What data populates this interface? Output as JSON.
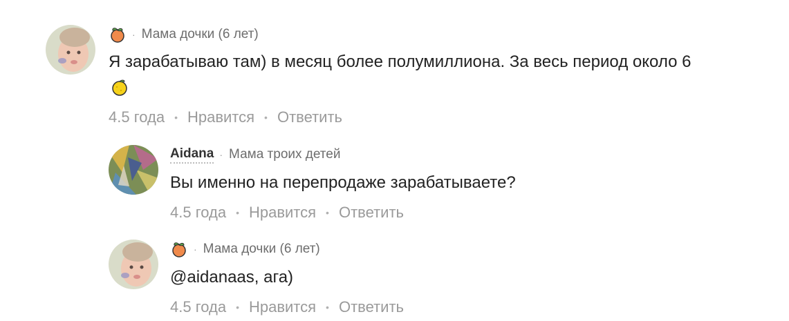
{
  "comments": [
    {
      "author_badge": "peach-badge",
      "subtitle": "Мама дочки (6 лет)",
      "text_line1": "Я зарабатываю там) в месяц более полумиллиона. За весь период около 6",
      "text_emoji": "lemon-emoji",
      "time": "4.5 года",
      "like_label": "Нравится",
      "reply_label": "Ответить"
    },
    {
      "author_name": "Aidana",
      "subtitle": "Мама троих детей",
      "text": "Вы именно на перепродаже зарабатываете?",
      "time": "4.5 года",
      "like_label": "Нравится",
      "reply_label": "Ответить"
    },
    {
      "author_badge": "peach-badge",
      "subtitle": "Мама дочки (6 лет)",
      "text": "@aidanaas, ага)",
      "time": "4.5 года",
      "like_label": "Нравится",
      "reply_label": "Ответить"
    }
  ],
  "separator_dot": "•",
  "meta_dot": "·",
  "colors": {
    "text": "#222222",
    "meta": "#6d6d6d",
    "actions": "#9a9a9a",
    "peach": "#f08a4b",
    "lemon": "#f6d21a"
  }
}
